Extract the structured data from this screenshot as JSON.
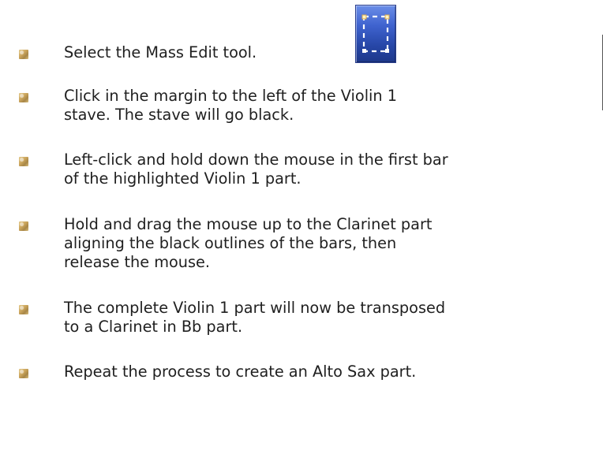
{
  "steps": [
    {
      "lines": [
        "Select the Mass Edit tool."
      ]
    },
    {
      "lines": [
        "Click in the margin to the left of the Violin 1",
        "stave. The stave will go black."
      ]
    },
    {
      "lines": [
        "Left-click and hold down the mouse in the first bar",
        "of the highlighted Violin 1 part."
      ]
    },
    {
      "lines": [
        "Hold and drag the mouse up to the Clarinet part",
        "aligning the black outlines of the bars, then",
        "release the mouse."
      ]
    },
    {
      "lines": [
        "The complete Violin 1 part will now be transposed",
        "to a Clarinet in Bb part."
      ]
    },
    {
      "lines": [
        "Repeat the process to create an Alto Sax part."
      ]
    }
  ],
  "icons": {
    "bullet": "square-bullet-icon",
    "tool": "mass-edit-selection-icon"
  },
  "colors": {
    "text": "#1f1f1f",
    "bullet": "#c9a35a",
    "tool_background": "#3f63cf"
  }
}
